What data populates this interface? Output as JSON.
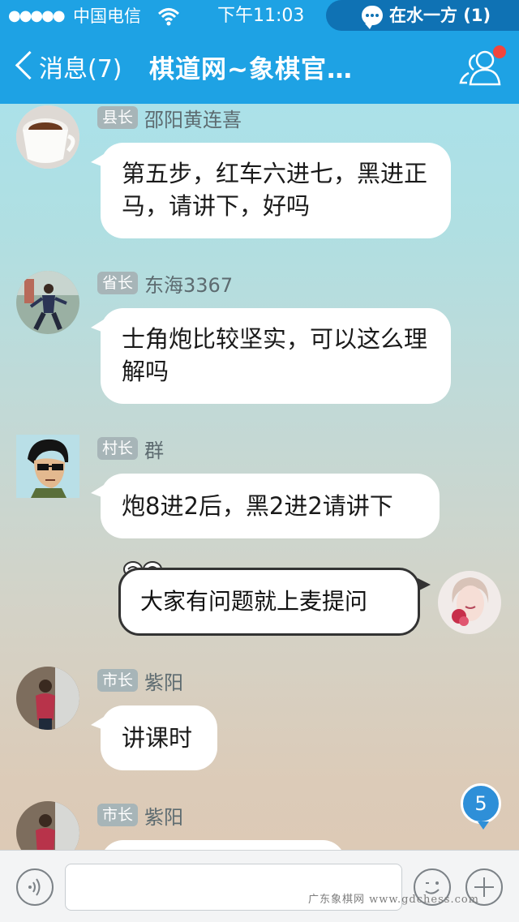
{
  "status_bar": {
    "signal": "●●●●●",
    "carrier": "中国电信",
    "time": "下午11:03",
    "active_chat_pill": "在水一方 (1)"
  },
  "nav": {
    "back_label": "消息(7)",
    "title": "棋道网~象棋官…"
  },
  "messages": [
    {
      "rank": "县长",
      "name": "邵阳黄连喜",
      "text": "第五步，红车六进七，黑进正马，请讲下，好吗"
    },
    {
      "rank": "省长",
      "name": "东海3367",
      "text": "士角炮比较坚实，可以这么理解吗"
    },
    {
      "rank": "村长",
      "name": "群",
      "text": "炮8进2后，黑2进2请讲下"
    },
    {
      "rank": "市长",
      "name": "紫阳",
      "text": "讲课时"
    },
    {
      "rank": "市长",
      "name": "紫阳",
      "text": ""
    }
  ],
  "my_message": {
    "text": "大家有问题就上麦提问"
  },
  "unread_badge": "5",
  "input": {
    "placeholder": ""
  },
  "watermark": "广东象棋网 www.gdchess.com",
  "colors": {
    "header": "#1ea2e4",
    "pill": "#0f72b4",
    "badge": "#2e8fd8",
    "notification_dot": "#f2453d"
  }
}
